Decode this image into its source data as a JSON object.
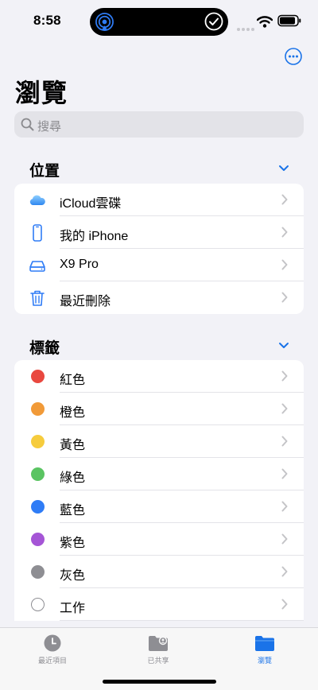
{
  "status": {
    "time": "8:58"
  },
  "page_title": "瀏覽",
  "search": {
    "placeholder": "搜尋"
  },
  "locations": {
    "header": "位置",
    "items": [
      {
        "label": "iCloud雲碟",
        "icon": "icloud-icon"
      },
      {
        "label": "我的 iPhone",
        "icon": "iphone-icon"
      },
      {
        "label": "X9 Pro",
        "icon": "external-drive-icon"
      },
      {
        "label": "最近刪除",
        "icon": "trash-icon"
      }
    ]
  },
  "tags": {
    "header": "標籤",
    "items": [
      {
        "label": "紅色",
        "color": "#e9483f"
      },
      {
        "label": "橙色",
        "color": "#f19a38"
      },
      {
        "label": "黃色",
        "color": "#f6cc3d"
      },
      {
        "label": "綠色",
        "color": "#5ac462"
      },
      {
        "label": "藍色",
        "color": "#2f7cf6"
      },
      {
        "label": "紫色",
        "color": "#a555d6"
      },
      {
        "label": "灰色",
        "color": "#8e8e93"
      },
      {
        "label": "工作",
        "color": "#ffffff"
      }
    ]
  },
  "tabbar": {
    "tabs": [
      {
        "label": "最近項目",
        "icon": "clock-icon",
        "active": false
      },
      {
        "label": "已共享",
        "icon": "shared-folder-icon",
        "active": false
      },
      {
        "label": "瀏覽",
        "icon": "folder-icon",
        "active": true
      }
    ]
  },
  "colors": {
    "accent": "#1a73e8",
    "background": "#f2f2f7"
  }
}
